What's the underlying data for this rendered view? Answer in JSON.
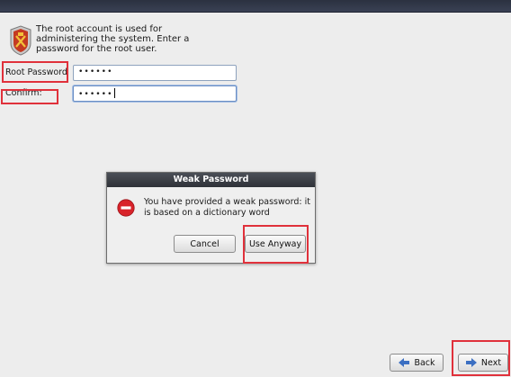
{
  "header": {
    "description": "The root account is used for administering the system.  Enter a password for the root user.",
    "icon": "security-badge-icon"
  },
  "form": {
    "root_password_label": "Root Password",
    "root_password_value": "••••••",
    "confirm_label": "Confirm:",
    "confirm_value": "••••••"
  },
  "dialog": {
    "title": "Weak Password",
    "icon": "error-icon",
    "message": "You have provided a weak password: it is based on a dictionary word",
    "cancel_label": "Cancel",
    "use_anyway_label": "Use Anyway"
  },
  "navigation": {
    "back_label": "Back",
    "next_label": "Next",
    "back_icon": "arrow-left-icon",
    "next_icon": "arrow-right-icon"
  },
  "colors": {
    "highlight": "#e0313b",
    "arrow": "#3b6fc2",
    "error": "#d8232a"
  }
}
